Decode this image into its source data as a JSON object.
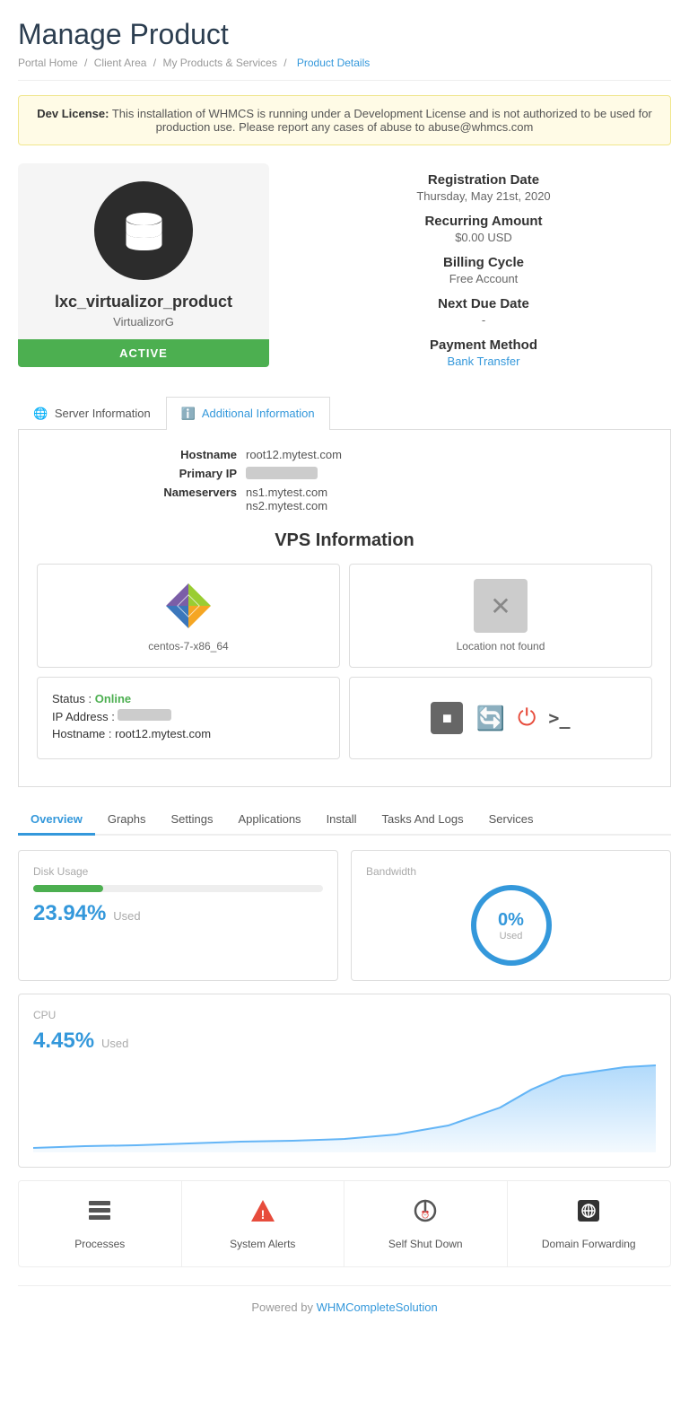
{
  "page": {
    "title": "Manage Product",
    "breadcrumbs": [
      {
        "label": "Portal Home",
        "active": false
      },
      {
        "label": "Client Area",
        "active": false
      },
      {
        "label": "My Products & Services",
        "active": false
      },
      {
        "label": "Product Details",
        "active": true
      }
    ]
  },
  "alert": {
    "bold": "Dev License:",
    "text": " This installation of WHMCS is running under a Development License and is not authorized to be used for production use. Please report any cases of abuse to abuse@whmcs.com"
  },
  "product": {
    "name": "lxc_virtualizor_product",
    "type": "VirtualizorG",
    "status": "ACTIVE",
    "registration_label": "Registration Date",
    "registration_value": "Thursday, May 21st, 2020",
    "recurring_label": "Recurring Amount",
    "recurring_value": "$0.00 USD",
    "billing_label": "Billing Cycle",
    "billing_value": "Free Account",
    "next_due_label": "Next Due Date",
    "next_due_value": "-",
    "payment_label": "Payment Method",
    "payment_value": "Bank Transfer"
  },
  "tabs": {
    "server": "Server Information",
    "additional": "Additional Information"
  },
  "server_info": {
    "hostname_label": "Hostname",
    "hostname_value": "root12.mytest.com",
    "primary_ip_label": "Primary IP",
    "primary_ip_value": "███████",
    "nameservers_label": "Nameservers",
    "ns1": "ns1.mytest.com",
    "ns2": "ns2.mytest.com"
  },
  "vps": {
    "section_title": "VPS Information",
    "os_name": "centos-7-x86_64",
    "location_label": "Location not found",
    "status_label": "Status :",
    "status_value": "Online",
    "ip_label": "IP Address :",
    "ip_value": "███████",
    "hostname_label": "Hostname :",
    "hostname_value": "root12.mytest.com"
  },
  "sub_tabs": [
    "Overview",
    "Graphs",
    "Settings",
    "Applications",
    "Install",
    "Tasks And Logs",
    "Services"
  ],
  "metrics": {
    "disk_label": "Disk Usage",
    "disk_pct": "23.94%",
    "disk_unit": "Used",
    "disk_fill_width": "24",
    "bandwidth_label": "Bandwidth",
    "bandwidth_pct": "0%",
    "bandwidth_unit": "Used",
    "cpu_label": "CPU",
    "cpu_pct": "4.45%",
    "cpu_unit": "Used"
  },
  "bottom_actions": [
    {
      "icon": "processes",
      "label": "Processes"
    },
    {
      "icon": "alert",
      "label": "System Alerts"
    },
    {
      "icon": "shutdown",
      "label": "Self Shut Down"
    },
    {
      "icon": "domain",
      "label": "Domain Forwarding"
    }
  ],
  "footer": {
    "text": "Powered by ",
    "link_text": "WHMCompleteSolution",
    "link_href": "#"
  }
}
